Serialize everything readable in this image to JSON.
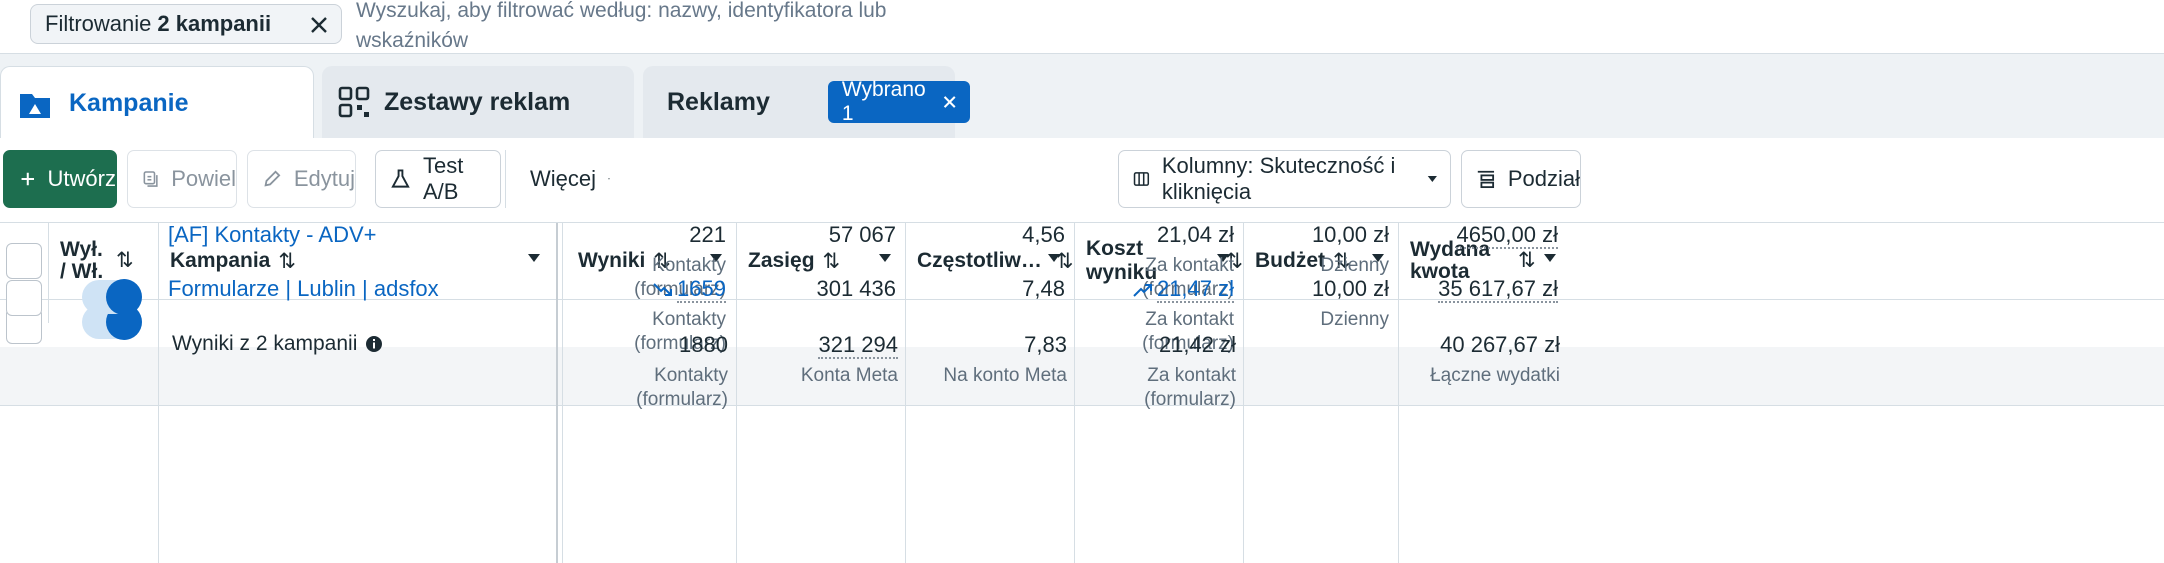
{
  "filter": {
    "chip_prefix": "Filtrowanie",
    "chip_bold": "2 kampanii",
    "search_placeholder": "Wyszukaj, aby filtrować według: nazwy, identyfikatora lub wskaźników"
  },
  "tabs": [
    {
      "label": "Kampanie",
      "icon": "folder-icon",
      "active": true
    },
    {
      "label": "Zestawy reklam",
      "icon": "grid-icon",
      "active": false
    },
    {
      "label": "Reklamy",
      "icon": "window-icon",
      "active": false,
      "badge": "Wybrano 1"
    }
  ],
  "toolbar": {
    "create": "Utwórz",
    "duplicate": "Powiel",
    "edit": "Edytuj",
    "ab_test": "Test A/B",
    "more": "Więcej",
    "columns": "Kolumny: Skuteczność i kliknięcia",
    "breakdown": "Podział"
  },
  "columns": {
    "toggle": "Wył. / Wł.",
    "campaign": "Kampania",
    "results": "Wyniki",
    "reach": "Zasięg",
    "frequency": "Częstotliw…",
    "cost": "Koszt wyniku",
    "budget": "Budżet",
    "spent": "Wydana kwota"
  },
  "rows": [
    {
      "name": "[AF] Kontakty - ADV+",
      "results": "221",
      "results_sub": "Kontakty (formularz)",
      "reach": "57 067",
      "frequency": "4,56",
      "cost": "21,04 zł",
      "cost_sub": "Za kontakt (formularz)",
      "budget": "10,00 zł",
      "budget_sub": "Dzienny",
      "spent": "4650,00 zł"
    },
    {
      "name": "Formularze | Lublin | adsfox",
      "results": "1659",
      "results_sub": "Kontakty (formularz)",
      "reach": "301 436",
      "frequency": "7,48",
      "cost": "21,47 zł",
      "cost_sub": "Za kontakt (formularz)",
      "budget": "10,00 zł",
      "budget_sub": "Dzienny",
      "spent": "35 617,67 zł"
    }
  ],
  "summary": {
    "label": "Wyniki z 2 kampanii",
    "results": "1880",
    "results_sub": "Kontakty (formularz)",
    "reach": "321 294",
    "reach_sub": "Konta Meta",
    "frequency": "7,83",
    "frequency_sub": "Na konto Meta",
    "cost": "21,42 zł",
    "cost_sub": "Za kontakt (formularz)",
    "spent": "40 267,67 zł",
    "spent_sub": "Łączne wydatki"
  },
  "colors": {
    "accent": "#0a66c2",
    "create_button": "#1d6e4f"
  }
}
